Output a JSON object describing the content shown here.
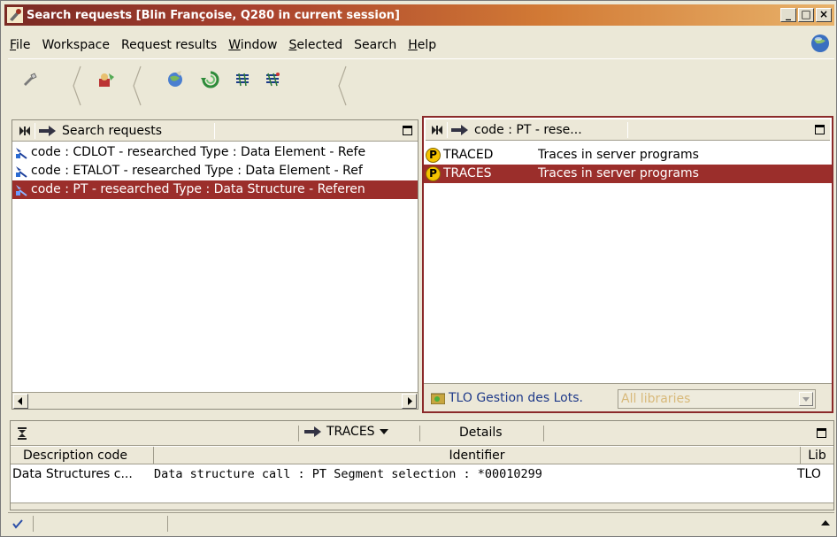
{
  "window": {
    "title": "Search requests [Blin Françoise, Q280 in current session]",
    "controls": {
      "minimize": "_",
      "maximize": "□",
      "close": "×"
    }
  },
  "menu": [
    {
      "label": "File",
      "underline": "F"
    },
    {
      "label": "Workspace",
      "underline": ""
    },
    {
      "label": "Request results",
      "underline": ""
    },
    {
      "label": "Window",
      "underline": "W"
    },
    {
      "label": "Selected",
      "underline": "S"
    },
    {
      "label": "Search",
      "underline": ""
    },
    {
      "label": "Help",
      "underline": "H"
    }
  ],
  "toolbar": {
    "buttons": [
      "wand-icon",
      "run-query-icon",
      "globe-search-icon",
      "refresh-icon",
      "list-icon",
      "list-filter-icon"
    ]
  },
  "left_panel": {
    "title": "Search requests",
    "rows": [
      {
        "text": "code : CDLOT - researched Type : Data Element - Refe",
        "selected": false
      },
      {
        "text": "code : ETALOT - researched Type : Data Element - Ref",
        "selected": false
      },
      {
        "text": "code : PT - researched Type : Data Structure - Referen",
        "selected": true
      }
    ]
  },
  "right_panel": {
    "title": "code : PT - rese...",
    "rows": [
      {
        "badge": "P",
        "code": "TRACED",
        "desc": "Traces in server programs",
        "selected": false
      },
      {
        "badge": "P",
        "code": "TRACES",
        "desc": "Traces in server programs",
        "selected": true
      }
    ],
    "library_label": "TLO Gestion des Lots.",
    "library_combo": "All libraries"
  },
  "bottom_panel": {
    "dropdown": "TRACES",
    "details": "Details",
    "columns": [
      "Description code",
      "Identifier",
      "Lib"
    ],
    "rows": [
      {
        "description": "Data Structures c...",
        "identifier": "Data structure call : PT Segment selection : *00010299",
        "lib": "TLO"
      }
    ]
  },
  "colors": {
    "selection": "#9b2e2b",
    "titlebar_start": "#7a2a24",
    "titlebar_end": "#e8b26a",
    "panel_border_active": "#8b2a2a"
  }
}
